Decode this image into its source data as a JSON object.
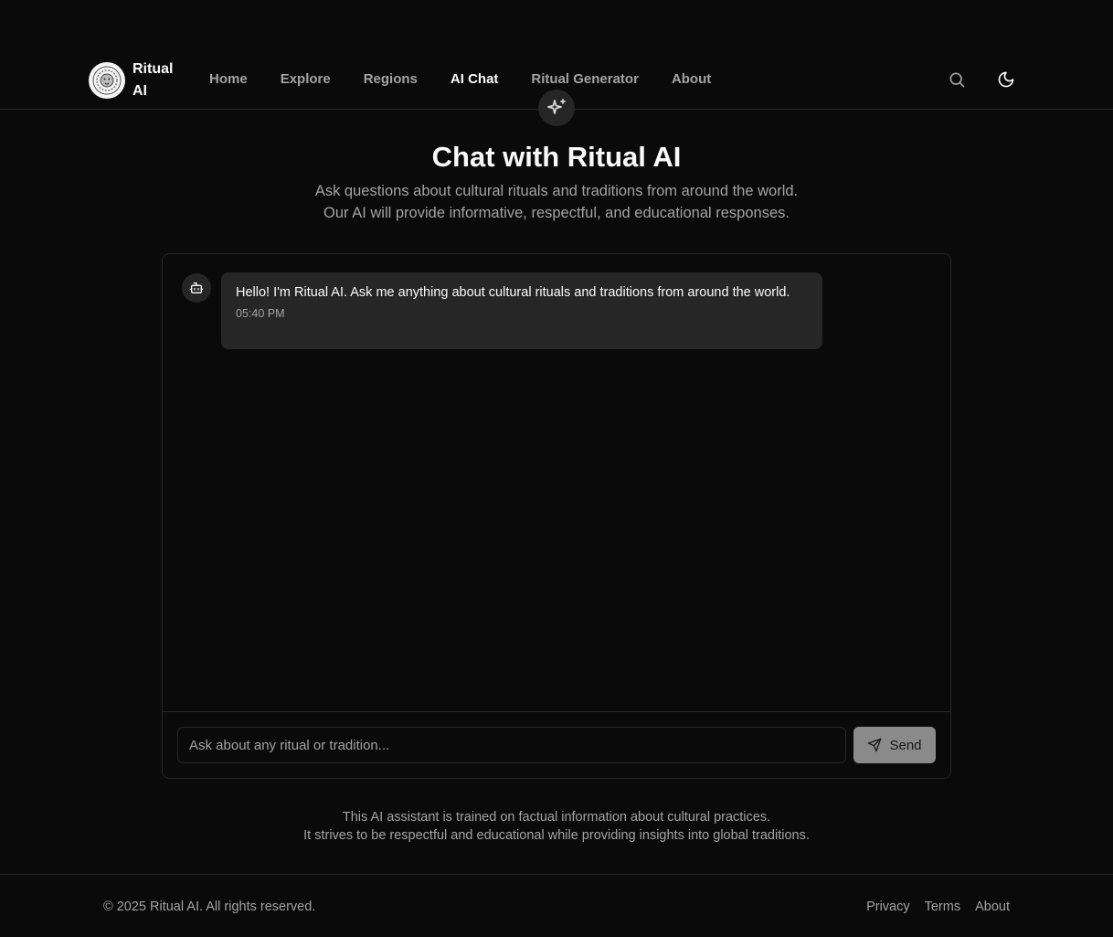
{
  "brand": {
    "name": "Ritual AI",
    "logo_icon": "lion-emblem-icon"
  },
  "nav": {
    "items": [
      {
        "label": "Home",
        "active": false
      },
      {
        "label": "Explore",
        "active": false
      },
      {
        "label": "Regions",
        "active": false
      },
      {
        "label": "AI Chat",
        "active": true
      },
      {
        "label": "Ritual Generator",
        "active": false
      },
      {
        "label": "About",
        "active": false
      }
    ]
  },
  "header_actions": {
    "search_icon": "search-icon",
    "theme_icon": "moon-icon"
  },
  "hero": {
    "badge_icon": "sparkles-icon",
    "title": "Chat with Ritual AI",
    "subtitle_line1": "Ask questions about cultural rituals and traditions from around the world.",
    "subtitle_line2": "Our AI will provide informative, respectful, and educational responses."
  },
  "chat": {
    "messages": [
      {
        "sender": "bot",
        "avatar_icon": "bot-icon",
        "text": "Hello! I'm Ritual AI. Ask me anything about cultural rituals and traditions from around the world.",
        "time": "05:40 PM"
      }
    ],
    "input": {
      "placeholder": "Ask about any ritual or tradition...",
      "value": ""
    },
    "send_label": "Send",
    "send_icon": "send-icon"
  },
  "disclaimer": {
    "line1": "This AI assistant is trained on factual information about cultural practices.",
    "line2": "It strives to be respectful and educational while providing insights into global traditions."
  },
  "footer": {
    "copyright": "© 2025 Ritual AI. All rights reserved.",
    "links": [
      "Privacy",
      "Terms",
      "About"
    ]
  },
  "colors": {
    "background": "#0a0a0a",
    "surface": "#262626",
    "text": "#fafafa",
    "muted": "#a3a3a3",
    "send_button": "#8a8a8a"
  }
}
